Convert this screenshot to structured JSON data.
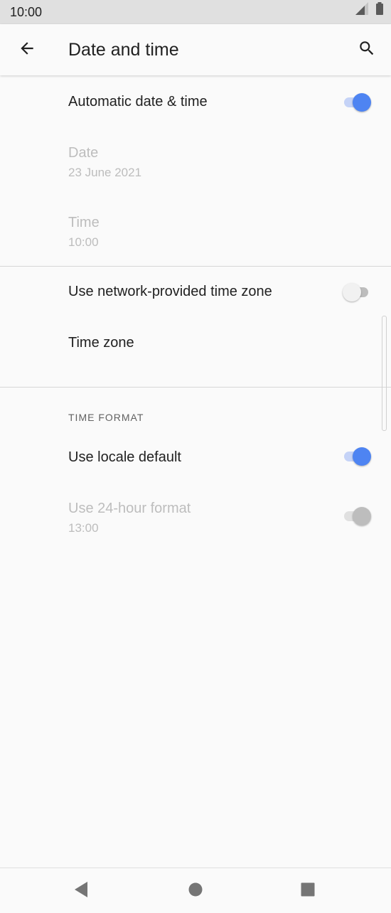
{
  "status_bar": {
    "time": "10:00",
    "icons": [
      "signal-icon",
      "battery-icon"
    ]
  },
  "app_bar": {
    "title": "Date and time",
    "back_icon": "arrow-back-icon",
    "search_icon": "search-icon"
  },
  "settings": {
    "automatic_date_time": {
      "title": "Automatic date & time",
      "enabled": true,
      "checked": true
    },
    "date": {
      "title": "Date",
      "value": "23 June 2021",
      "enabled": false
    },
    "time": {
      "title": "Time",
      "value": "10:00",
      "enabled": false
    },
    "network_time_zone": {
      "title": "Use network-provided time zone",
      "enabled": true,
      "checked": false
    },
    "time_zone": {
      "title": "Time zone",
      "enabled": true
    },
    "time_format_header": "TIME FORMAT",
    "use_locale_default": {
      "title": "Use locale default",
      "enabled": true,
      "checked": true
    },
    "use_24_hour": {
      "title": "Use 24-hour format",
      "value": "13:00",
      "enabled": false,
      "checked": true
    }
  },
  "nav_bar": {
    "back_icon": "nav-back-icon",
    "home_icon": "nav-home-icon",
    "recents_icon": "nav-recents-icon"
  },
  "colors": {
    "accent": "#4e84f2",
    "accent_track": "#c5d3f7",
    "disabled_text": "#bdbdbd",
    "background": "#fafafa",
    "status_bar": "#e0e0e0"
  }
}
